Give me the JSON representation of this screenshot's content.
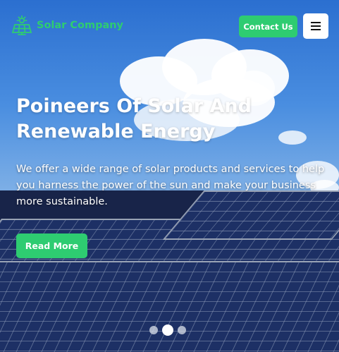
{
  "header": {
    "brand_name": "Solar Company",
    "brand_icon": "solar-panel-icon",
    "contact_label": "Contact Us",
    "menu_icon": "hamburger-menu-icon"
  },
  "hero": {
    "headline": "Poineers Of Solar And Renewable Energy",
    "subtext": "We offer a wide range of solar products and services to help you harness the power of the sun and make your business more sustainable.",
    "cta_label": "Read More"
  },
  "carousel": {
    "slide_count": 3,
    "active_index": 1
  },
  "colors": {
    "accent": "#2ecc71",
    "text_on_hero": "#ffffff"
  }
}
